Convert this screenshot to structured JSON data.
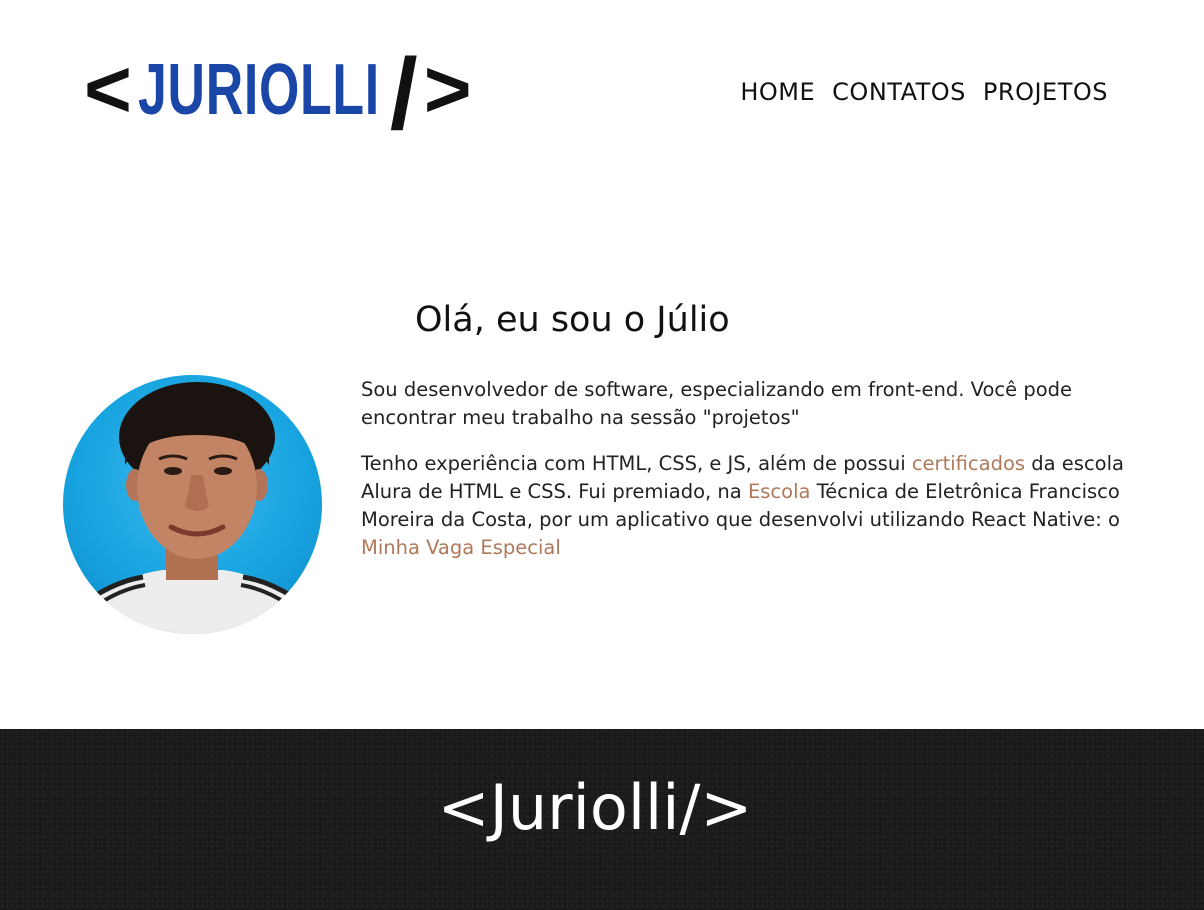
{
  "header": {
    "logo": {
      "open": "<",
      "name": "JURIOLLI",
      "slash": "/",
      "close": ">"
    },
    "nav": [
      "HOME",
      "CONTATOS",
      "PROJETOS"
    ]
  },
  "main": {
    "heading": "Olá, eu sou o Júlio",
    "avatar_alt": "avatar-photo",
    "paragraph1": "Sou desenvolvedor de software, especializando em front-end. Você pode encontrar meu trabalho na sessão \"projetos\"",
    "paragraph2": {
      "t1": "Tenho experiência com HTML, CSS, e JS, além de possui ",
      "link_certificados": "certificados",
      "t2": " da escola Alura de HTML e CSS. Fui premiado, na ",
      "link_escola": "Escola",
      "t3": " Técnica de Eletrônica Francisco Moreira da Costa, por um aplicativo que desenvolvi utilizando React Native: o ",
      "link_app": "Minha Vaga Especial"
    }
  },
  "footer": {
    "logo": "<Juriolli/>"
  },
  "colors": {
    "logo_blue": "#1a46a8",
    "link": "#b0785a",
    "footer_bg": "#1b1b1b",
    "avatar_bg": "#17a4e0"
  }
}
